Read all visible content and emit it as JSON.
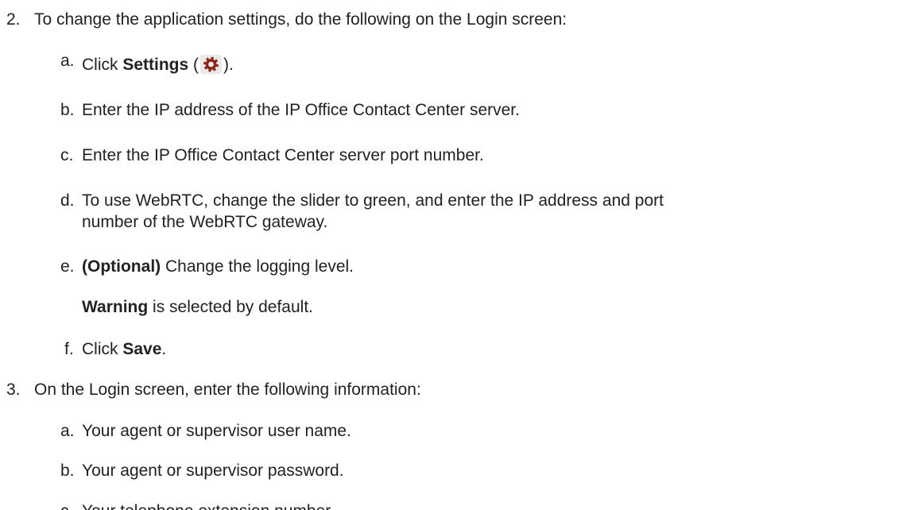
{
  "steps": [
    {
      "marker": "2.",
      "text": "To change the application settings, do the following on the Login screen:",
      "substeps": [
        {
          "marker": "a.",
          "prefix": "Click ",
          "bold": "Settings",
          "open_paren": " (",
          "icon": "gear-icon",
          "close_paren": ")."
        },
        {
          "marker": "b.",
          "text": "Enter the IP address of the IP Office Contact Center server."
        },
        {
          "marker": "c.",
          "text": "Enter the IP Office Contact Center server port number."
        },
        {
          "marker": "d.",
          "line1": "To use WebRTC, change the slider to green, and enter the IP address and port",
          "line2": "number of the WebRTC gateway."
        },
        {
          "marker": "e.",
          "bold": "(Optional)",
          "text": " Change the logging level.",
          "note_bold": "Warning",
          "note_text": " is selected by default."
        },
        {
          "marker": "f.",
          "prefix": "Click ",
          "bold": "Save",
          "suffix": "."
        }
      ]
    },
    {
      "marker": "3.",
      "text": "On the Login screen, enter the following information:",
      "substeps": [
        {
          "marker": "a.",
          "text": "Your agent or supervisor user name."
        },
        {
          "marker": "b.",
          "text": "Your agent or supervisor password."
        },
        {
          "marker": "c.",
          "text": "Your telephone extension number."
        }
      ]
    }
  ],
  "colors": {
    "text": "#222222",
    "gear_icon": "#8b2518"
  }
}
